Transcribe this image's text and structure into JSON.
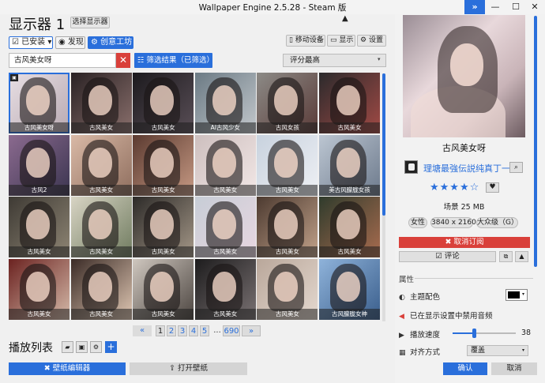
{
  "window": {
    "title": "Wallpaper Engine 2.5.28 - Steam 版",
    "expand_icon": "»",
    "minimize_icon": "—",
    "maximize_icon": "☐",
    "close_icon": "✕"
  },
  "header": {
    "display_title": "显示器 1",
    "select_display": "选择显示器"
  },
  "filters": {
    "installed": "☑ 已安装 ▾",
    "discover": "◉ 发现",
    "workshop": "⚙ 创意工坊"
  },
  "toolbar": {
    "mobile": "▯ 移动设备",
    "display": "▭ 显示",
    "settings": "⚙ 设置"
  },
  "search": {
    "value": "古风美女呀",
    "clear_icon": "✕"
  },
  "filter_results": "☷ 筛选结果（已筛选）",
  "sort": {
    "selected": "评分最高",
    "arrow": "▾"
  },
  "wallpapers": [
    {
      "caption": "古风美女呀",
      "bg": "linear-gradient(135deg,#e8dfe4,#b8a9b1)"
    },
    {
      "caption": "古风美女",
      "bg": "linear-gradient(135deg,#2a2224,#8a6f6c)"
    },
    {
      "caption": "古风美女",
      "bg": "linear-gradient(135deg,#1c1a1e,#5a4f57)"
    },
    {
      "caption": "AI古风少女",
      "bg": "linear-gradient(135deg,#6b7a84,#c3c8cc)"
    },
    {
      "caption": "古风女孩",
      "bg": "linear-gradient(135deg,#8c8a86,#5a3b38)"
    },
    {
      "caption": "古风美女",
      "bg": "linear-gradient(135deg,#2b2a2c,#a24a45)"
    },
    {
      "caption": "古风2",
      "bg": "linear-gradient(135deg,#8b6a8f,#3b3550)"
    },
    {
      "caption": "古风美女",
      "bg": "linear-gradient(135deg,#d9b9a6,#8f6e5e)"
    },
    {
      "caption": "古风美女",
      "bg": "linear-gradient(135deg,#5b3a30,#c79a84)"
    },
    {
      "caption": "古风美女",
      "bg": "linear-gradient(135deg,#cdbfbe,#f2e7e6)"
    },
    {
      "caption": "古风美女",
      "bg": "linear-gradient(135deg,#c8d2de,#eef0f4)"
    },
    {
      "caption": "美古风朦胧女孩",
      "bg": "linear-gradient(135deg,#bcc6d2,#6d7a8c)"
    },
    {
      "caption": "古风美女",
      "bg": "linear-gradient(135deg,#3e3a34,#8e8574)"
    },
    {
      "caption": "古风美女",
      "bg": "linear-gradient(135deg,#d8d4c4,#6f7b5f)"
    },
    {
      "caption": "古风美女",
      "bg": "linear-gradient(135deg,#2c2a28,#a59888)"
    },
    {
      "caption": "古风美女",
      "bg": "linear-gradient(135deg,#c7cdd6,#e8d6e0)"
    },
    {
      "caption": "古风美女",
      "bg": "linear-gradient(135deg,#4c3a30,#c2a28a)"
    },
    {
      "caption": "古风美女",
      "bg": "linear-gradient(135deg,#2f3b2c,#a96c4f)"
    },
    {
      "caption": "古风美女",
      "bg": "linear-gradient(135deg,#6b2220,#d4b9a8)"
    },
    {
      "caption": "古风美女",
      "bg": "linear-gradient(135deg,#3a2b26,#e0c7b3)"
    },
    {
      "caption": "古风美女",
      "bg": "linear-gradient(135deg,#cfc7bf,#4c4540)"
    },
    {
      "caption": "古风美女",
      "bg": "linear-gradient(135deg,#1d1c1d,#7a7273)"
    },
    {
      "caption": "古风美女",
      "bg": "linear-gradient(135deg,#b9a79a,#e4d8cf)"
    },
    {
      "caption": "古风朦胧女神",
      "bg": "linear-gradient(135deg,#8fb3da,#3a5e8c)"
    }
  ],
  "pagination": {
    "first_icon": "«",
    "pages": [
      "1",
      "2",
      "3",
      "4",
      "5"
    ],
    "ellipsis": "...",
    "last": "690",
    "next_icon": "»"
  },
  "playlist": {
    "title": "播放列表",
    "folder_icon": "▰",
    "save_icon": "▣",
    "config_icon": "⚙",
    "add_icon": "+"
  },
  "bottom": {
    "editor": "✖ 壁纸编辑器",
    "open": "⇪ 打开壁纸"
  },
  "detail": {
    "title": "古风美女呀",
    "author": "理塘最強伝説纯真丁一",
    "search_icon": "🔍",
    "rating": "★★★★☆",
    "rating_value": 4,
    "fav_icon": "♥",
    "type_size": "场景  25 MB",
    "tags": [
      "女性",
      "3840 x 2160",
      "大众级（G）"
    ],
    "unsubscribe": "✖ 取消订阅",
    "comment": "☑ 评论",
    "copy_icon": "⧉",
    "report_icon": "▲"
  },
  "properties": {
    "label": "属性",
    "color_label": "主题配色",
    "palette_icon": "◐",
    "audio_label": "已在显示设置中禁用音频",
    "audio_icon": "◀",
    "speed_label": "播放速度",
    "play_icon": "▶",
    "speed_value": 38,
    "speed_max": 100,
    "align_label": "对齐方式",
    "align_icon": "▦",
    "align_value": "覆盖",
    "align_arrow": "▾"
  },
  "actions": {
    "ok": "确认",
    "cancel": "取消"
  },
  "colors": {
    "accent": "#2a6fdb",
    "danger": "#d9403a"
  }
}
